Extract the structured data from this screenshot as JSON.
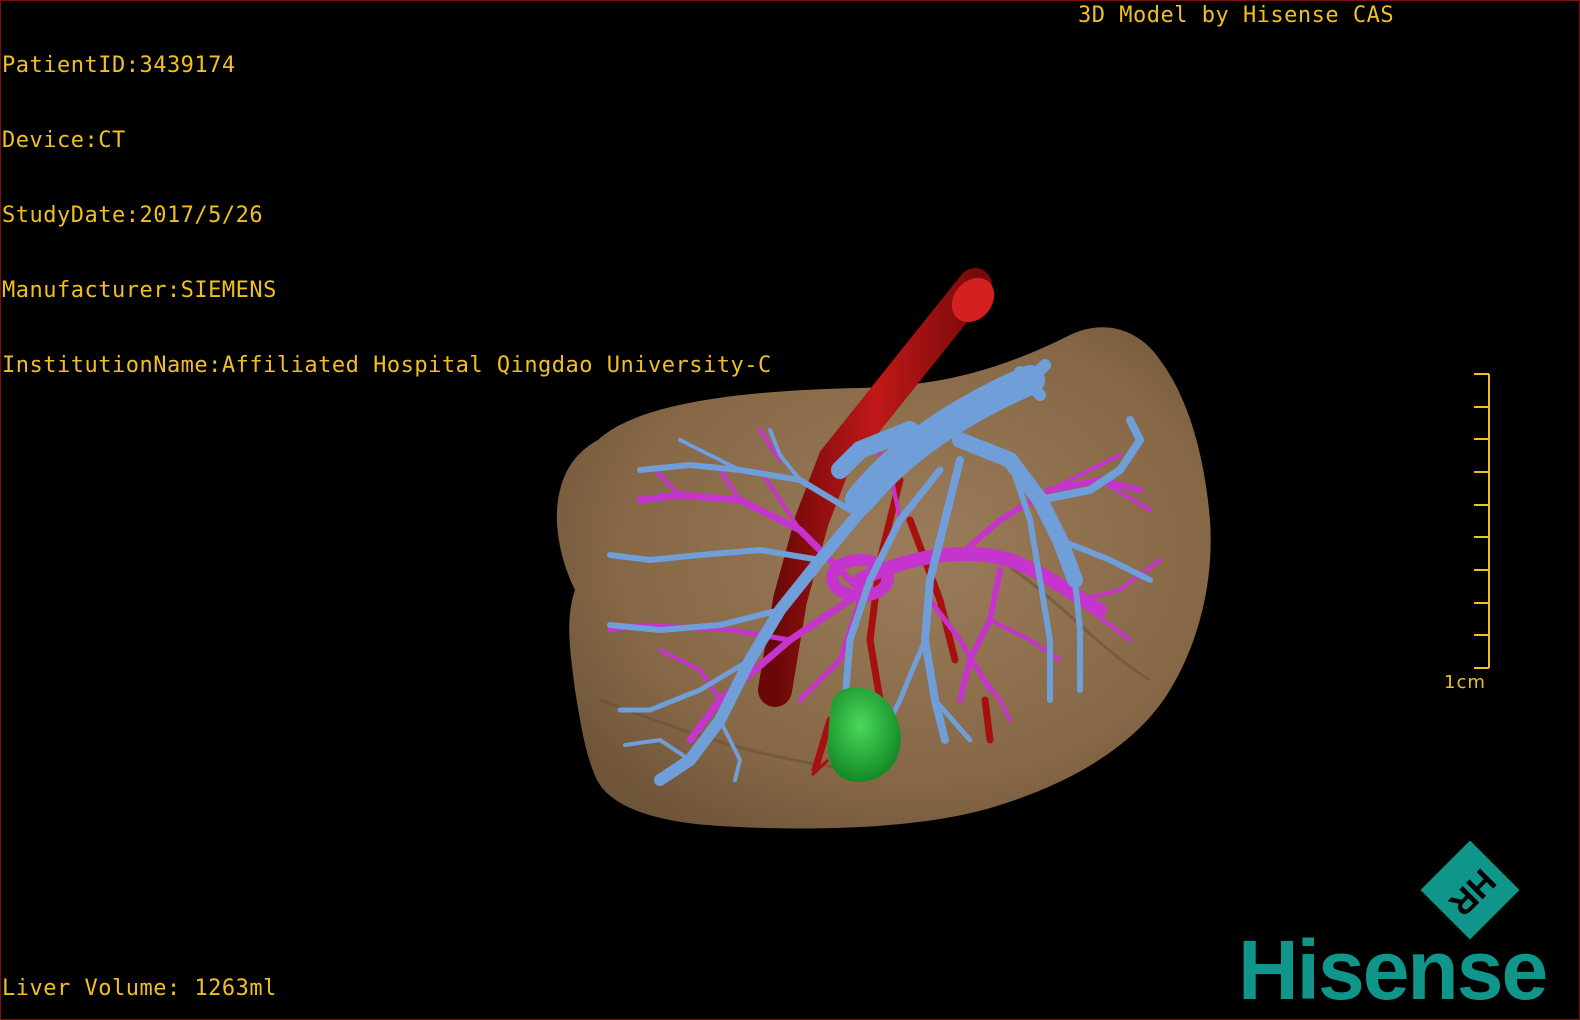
{
  "patient_info": {
    "patient_id": "PatientID:3439174",
    "device": "Device:CT",
    "study_date": "StudyDate:2017/5/26",
    "manufacturer": "Manufacturer:SIEMENS",
    "institution": "InstitutionName:Affiliated Hospital Qingdao University-C"
  },
  "header": {
    "model_credit": "3D Model by Hisense CAS"
  },
  "footer": {
    "liver_volume": "Liver Volume: 1263ml"
  },
  "scale": {
    "label": "1cm"
  },
  "logo": {
    "mark_text": "HR",
    "wordmark": "Hisense"
  },
  "colors": {
    "text": "#f0c020",
    "liver": "#8a6d4e",
    "portal_vein": "#6f9ed8",
    "hepatic_vein": "#c534cc",
    "artery": "#a81010",
    "lesion": "#22a83a",
    "brand": "#10958a"
  }
}
